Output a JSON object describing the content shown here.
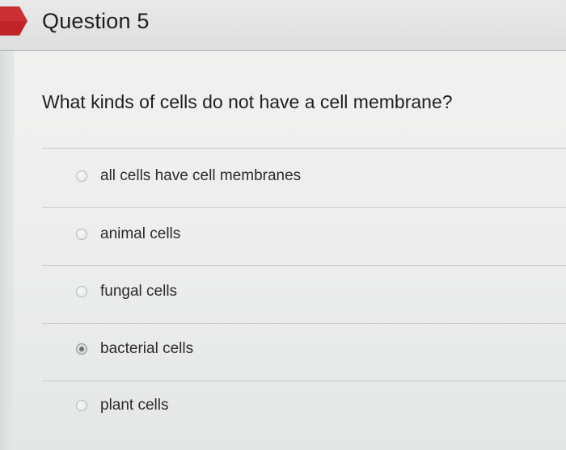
{
  "question": {
    "title": "Question 5",
    "prompt": "What kinds of cells do not have a cell membrane?",
    "options": [
      {
        "label": "all cells have cell membranes",
        "selected": false
      },
      {
        "label": "animal cells",
        "selected": false
      },
      {
        "label": "fungal cells",
        "selected": false
      },
      {
        "label": "bacterial cells",
        "selected": true
      },
      {
        "label": "plant cells",
        "selected": false
      }
    ]
  },
  "colors": {
    "flag": "#c0232a",
    "page_background": "#eeeeee",
    "header_background": "#e2e2e2",
    "text": "#1e1e1e"
  }
}
